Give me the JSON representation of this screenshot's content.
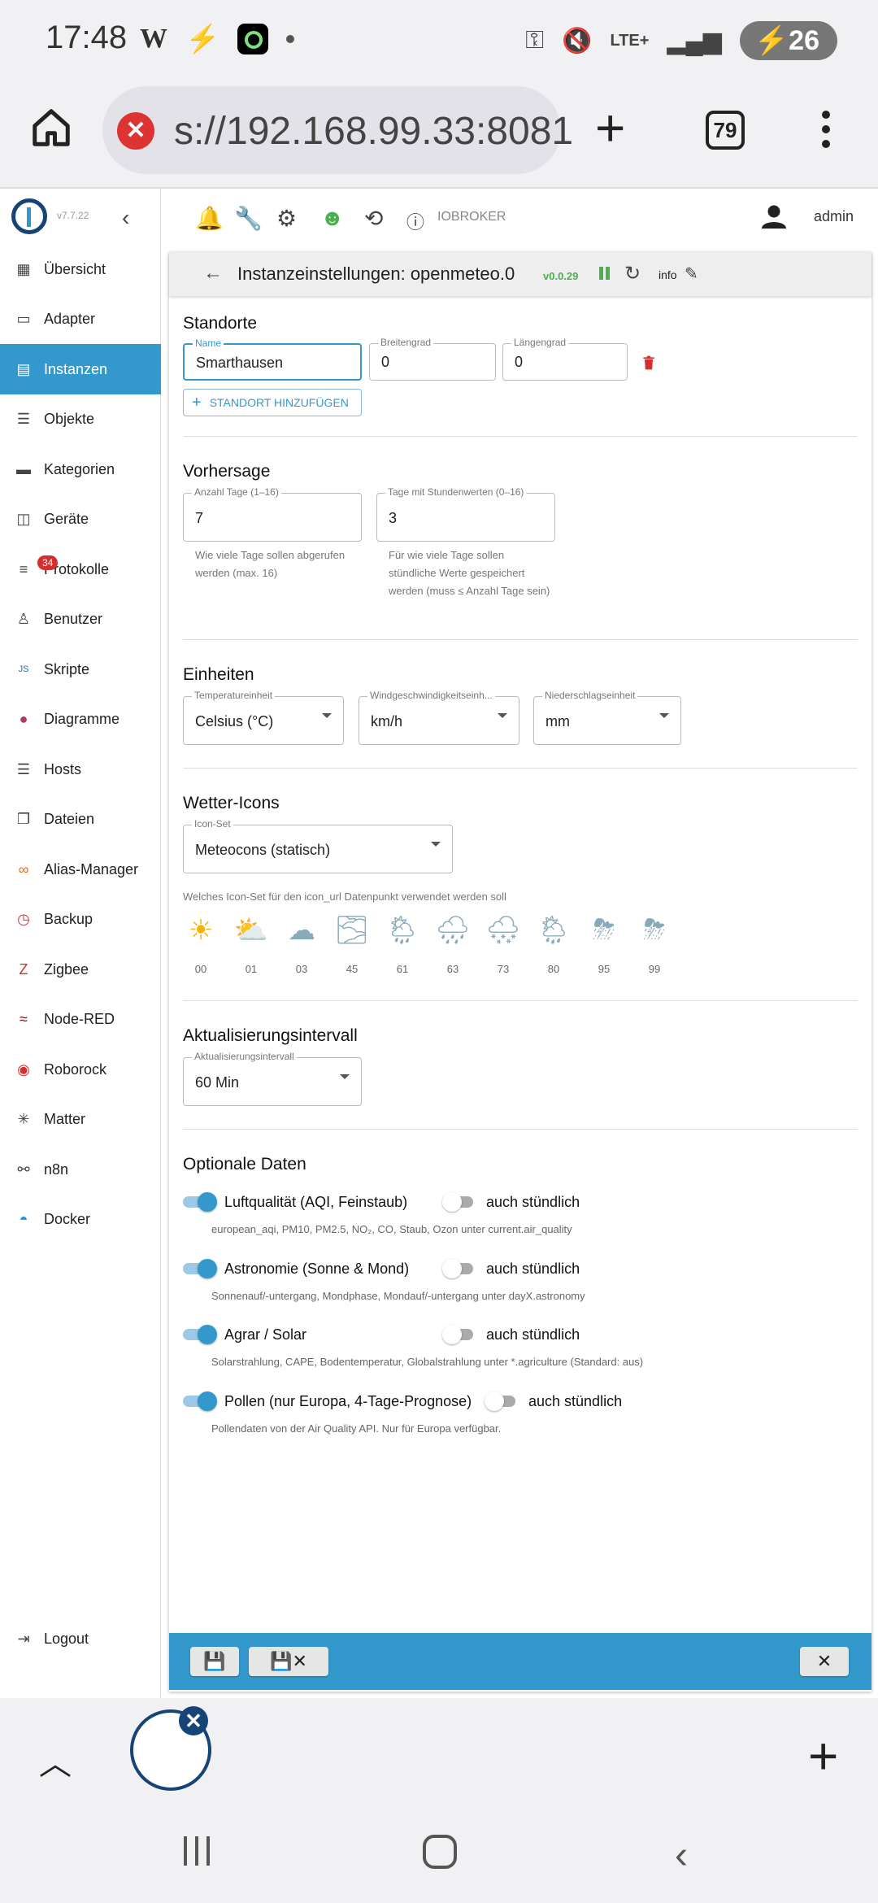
{
  "status": {
    "time": "17:48",
    "battery": "26",
    "network": "LTE+"
  },
  "browser": {
    "url": "s://192.168.99.33:8081",
    "tab_count": "79"
  },
  "sidebar": {
    "version": "v7.7.22",
    "items": [
      {
        "label": "Übersicht",
        "icon": "grid-icon"
      },
      {
        "label": "Adapter",
        "icon": "store-icon"
      },
      {
        "label": "Instanzen",
        "icon": "instances-icon"
      },
      {
        "label": "Objekte",
        "icon": "list-icon"
      },
      {
        "label": "Kategorien",
        "icon": "categories-icon"
      },
      {
        "label": "Geräte",
        "icon": "devices-icon"
      },
      {
        "label": "Protokolle",
        "icon": "log-icon",
        "badge": "34"
      },
      {
        "label": "Benutzer",
        "icon": "user-icon"
      },
      {
        "label": "Skripte",
        "icon": "js-icon"
      },
      {
        "label": "Diagramme",
        "icon": "chart-icon"
      },
      {
        "label": "Hosts",
        "icon": "hosts-icon"
      },
      {
        "label": "Dateien",
        "icon": "files-icon"
      },
      {
        "label": "Alias-Manager",
        "icon": "alias-icon"
      },
      {
        "label": "Backup",
        "icon": "backup-icon"
      },
      {
        "label": "Zigbee",
        "icon": "zigbee-icon"
      },
      {
        "label": "Node-RED",
        "icon": "nodered-icon"
      },
      {
        "label": "Roborock",
        "icon": "roborock-icon"
      },
      {
        "label": "Matter",
        "icon": "matter-icon"
      },
      {
        "label": "n8n",
        "icon": "n8n-icon"
      },
      {
        "label": "Docker",
        "icon": "docker-icon"
      }
    ],
    "logout": "Logout"
  },
  "appbar": {
    "host": "IOBROKER",
    "user": "admin"
  },
  "panel": {
    "title": "Instanzeinstellungen: openmeteo.0",
    "version": "v0.0.29",
    "info": "info",
    "locations": {
      "title": "Standorte",
      "name_label": "Name",
      "name_value": "Smarthausen",
      "lat_label": "Breitengrad",
      "lat_value": "0",
      "lon_label": "Längengrad",
      "lon_value": "0",
      "add_button": "STANDORT HINZUFÜGEN"
    },
    "forecast": {
      "title": "Vorhersage",
      "days_label": "Anzahl Tage (1–16)",
      "days_value": "7",
      "days_help": "Wie viele Tage sollen abgerufen werden (max. 16)",
      "hours_label": "Tage mit Stundenwerten (0–16)",
      "hours_value": "3",
      "hours_help": "Für wie viele Tage sollen stündliche Werte gespeichert werden (muss ≤ Anzahl Tage sein)"
    },
    "units": {
      "title": "Einheiten",
      "temp_label": "Temperatureinheit",
      "temp_value": "Celsius (°C)",
      "wind_label": "Windgeschwindigkeitseinh...",
      "wind_value": "km/h",
      "precip_label": "Niederschlagseinheit",
      "precip_value": "mm"
    },
    "icons": {
      "title": "Wetter-Icons",
      "set_label": "Icon-Set",
      "set_value": "Meteocons (statisch)",
      "help": "Welches Icon-Set für den icon_url Datenpunkt verwendet werden soll",
      "codes": [
        "00",
        "01",
        "03",
        "45",
        "61",
        "63",
        "73",
        "80",
        "95",
        "99"
      ]
    },
    "interval": {
      "title": "Aktualisierungsintervall",
      "label": "Aktualisierungsintervall",
      "value": "60 Min"
    },
    "optional": {
      "title": "Optionale Daten",
      "hourly_label": "auch stündlich",
      "items": [
        {
          "label": "Luftqualität (AQI, Feinstaub)",
          "sub": "european_aqi, PM10, PM2.5, NO₂, CO, Staub, Ozon unter current.air_quality",
          "enabled": true,
          "hourly": false
        },
        {
          "label": "Astronomie (Sonne & Mond)",
          "sub": "Sonnenauf/-untergang, Mondphase, Mondauf/-untergang unter dayX.astronomy",
          "enabled": true,
          "hourly": false
        },
        {
          "label": "Agrar / Solar",
          "sub": "Solarstrahlung, CAPE, Bodentemperatur, Globalstrahlung unter *.agriculture (Standard: aus)",
          "enabled": true,
          "hourly": false
        },
        {
          "label": "Pollen (nur Europa, 4-Tage-Prognose)",
          "sub": "Pollendaten von der Air Quality API. Nur für Europa verfügbar.",
          "enabled": true,
          "hourly": false
        }
      ]
    }
  },
  "colors": {
    "accent": "#3399cc",
    "brand": "#164477",
    "danger": "#d32f2f",
    "success": "#4caf50"
  }
}
